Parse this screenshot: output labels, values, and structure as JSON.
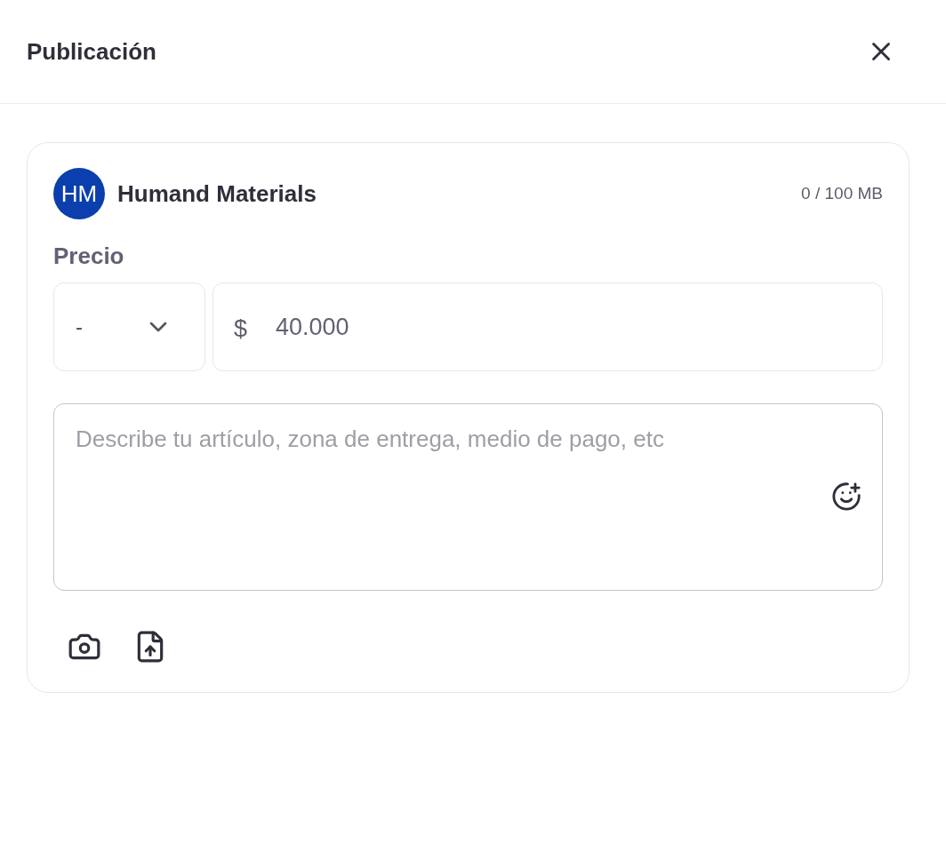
{
  "header": {
    "title": "Publicación"
  },
  "author": {
    "initials": "HM",
    "name": "Humand Materials",
    "storage": "0 / 100 MB"
  },
  "price": {
    "label": "Precio",
    "currency_select": "-",
    "symbol": "$",
    "value": "40.000"
  },
  "description": {
    "placeholder": "Describe tu artículo, zona de entrega, medio de pago, etc"
  }
}
